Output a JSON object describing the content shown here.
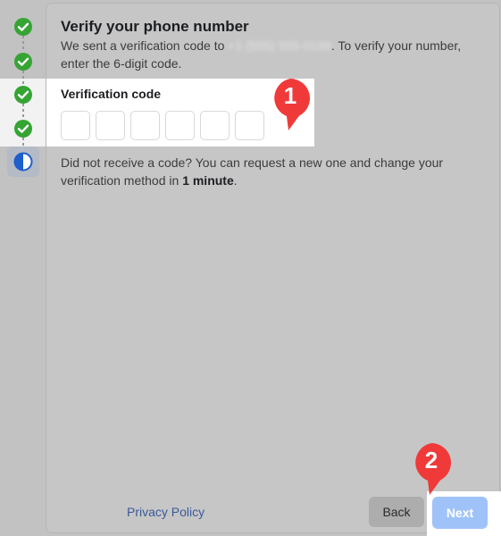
{
  "steps": [
    {
      "state": "done",
      "icon": "check-circle-icon"
    },
    {
      "state": "done",
      "icon": "check-circle-icon"
    },
    {
      "state": "done",
      "icon": "check-circle-icon"
    },
    {
      "state": "done",
      "icon": "check-circle-icon"
    },
    {
      "state": "current",
      "icon": "half-circle-icon"
    }
  ],
  "colors": {
    "success": "#35a433",
    "current": "#1d5fcc",
    "link": "#3b5998",
    "next_button": "#9fc3f9",
    "marker": "#f03a3a"
  },
  "header": {
    "title": "Verify your phone number",
    "desc_prefix": "We sent a verification code to",
    "phone": "+1 (555) 555-0199",
    "desc_suffix": ". To verify your number, enter the 6-digit code."
  },
  "code": {
    "label": "Verification code",
    "digits": [
      "",
      "",
      "",
      "",
      "",
      ""
    ]
  },
  "resend": {
    "text_prefix": "Did not receive a code? You can request a new one and change your verification method in",
    "time": "1 minute",
    "text_suffix": "."
  },
  "footer": {
    "privacy_label": "Privacy Policy",
    "back_label": "Back",
    "next_label": "Next"
  },
  "markers": [
    "1",
    "2"
  ]
}
